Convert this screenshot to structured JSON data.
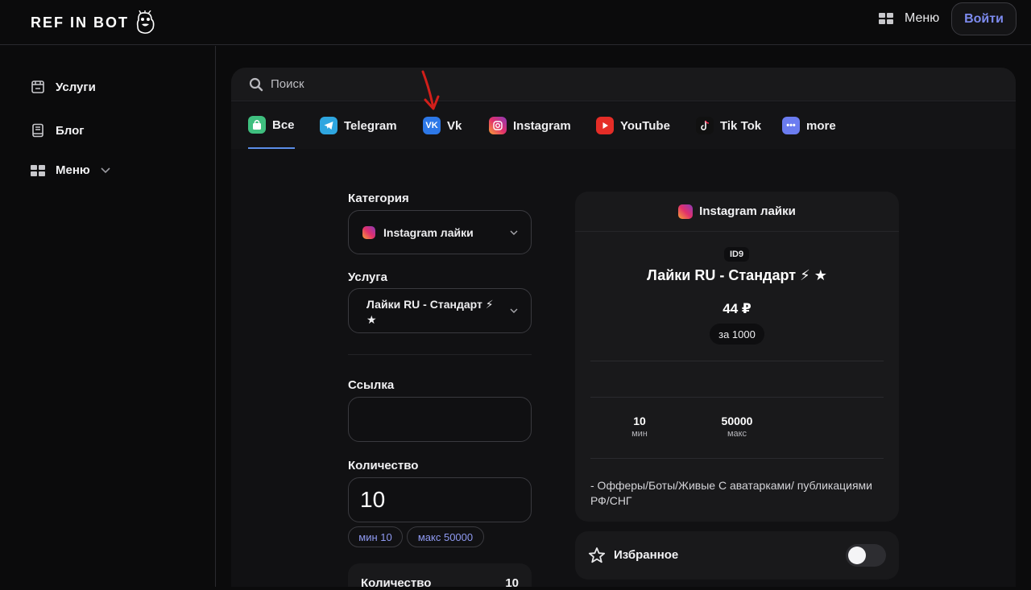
{
  "header": {
    "logo_text": "REF IN BOT",
    "menu_label": "Меню",
    "login_label": "Войти"
  },
  "sidebar": {
    "items": [
      {
        "label": "Услуги",
        "icon": "store-icon"
      },
      {
        "label": "Блог",
        "icon": "book-icon"
      },
      {
        "label": "Меню",
        "icon": "grid-icon"
      }
    ]
  },
  "search": {
    "placeholder": "Поиск"
  },
  "tabs": [
    {
      "label": "Все",
      "icon": "bag-icon",
      "color": "#3fbf7f",
      "active": true
    },
    {
      "label": "Telegram",
      "icon": "telegram-icon",
      "color": "#2ea6e0"
    },
    {
      "label": "Vk",
      "icon": "vk-icon",
      "color": "#2d78e8"
    },
    {
      "label": "Instagram",
      "icon": "instagram-icon",
      "color": "#e1306c"
    },
    {
      "label": "YouTube",
      "icon": "youtube-icon",
      "color": "#e52d27"
    },
    {
      "label": "Tik Tok",
      "icon": "tiktok-icon",
      "color": "#111111"
    },
    {
      "label": "more",
      "icon": "more-icon",
      "color": "#6b7cf0"
    }
  ],
  "form": {
    "category_label": "Категория",
    "category_value": "Instagram лайки",
    "service_label": "Услуга",
    "service_value": "Лайки RU - Стандарт ⚡ ★",
    "link_label": "Ссылка",
    "link_value": "",
    "quantity_label": "Количество",
    "quantity_value": "10",
    "min_pill": "мин 10",
    "max_pill": "макс 50000",
    "summary_label": "Количество",
    "summary_value": "10"
  },
  "card": {
    "header": "Instagram лайки",
    "id_badge": "ID9",
    "title": "Лайки RU - Стандарт ⚡ ★",
    "price": "44 ₽",
    "per": "за 1000",
    "min_value": "10",
    "min_label": "мин",
    "max_value": "50000",
    "max_label": "макс",
    "description": "- Офферы/Боты/Живые С аватарками/ публикациями РФ/СНГ"
  },
  "favorite": {
    "label": "Избранное",
    "enabled": false
  },
  "colors": {
    "accent": "#7d8bf0",
    "tab_underline": "#5b8de8",
    "annotation_arrow": "#d11f1a"
  }
}
